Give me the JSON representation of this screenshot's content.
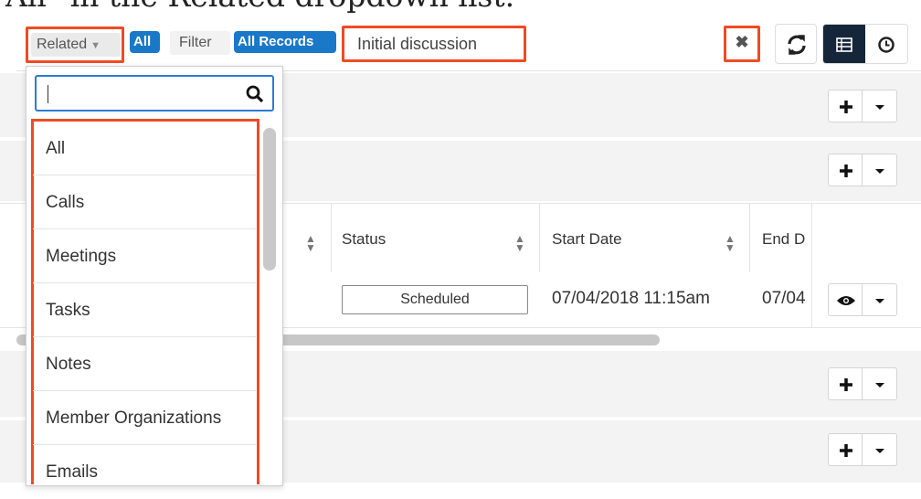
{
  "caption": "All\" in the Related dropdown list.",
  "toolbar": {
    "related_label": "Related",
    "all_pill": "All",
    "filter_label": "Filter",
    "records_pill": "All Records",
    "search_value": "Initial discussion",
    "clear_icon": "close-icon",
    "refresh_icon": "refresh-icon",
    "list_view_icon": "list-view-icon",
    "timeline_view_icon": "clock-icon"
  },
  "dropdown": {
    "search_value": "",
    "search_icon": "search-icon",
    "items": [
      "All",
      "Calls",
      "Meetings",
      "Tasks",
      "Notes",
      "Member Organizations",
      "Emails"
    ]
  },
  "table": {
    "headers": [
      "Status",
      "Start Date",
      "End D"
    ],
    "row": {
      "status": "Scheduled",
      "start_date": "07/04/2018 11:15am",
      "end_date": "07/04"
    }
  },
  "colors": {
    "accent_blue": "#1a78c8",
    "highlight_red": "#f04a24",
    "dark_navy": "#16263a"
  }
}
